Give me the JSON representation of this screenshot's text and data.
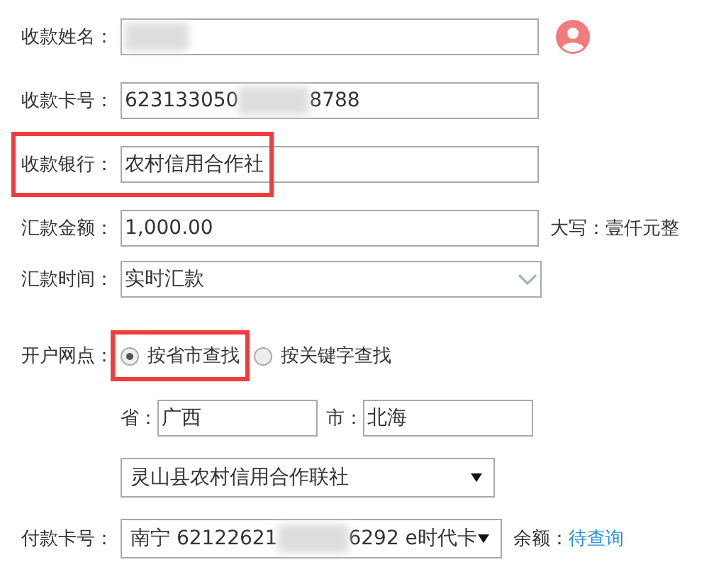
{
  "rows": [
    {
      "kind": "input",
      "label": "收款姓名：",
      "parts": [
        {
          "kind": "redacted"
        }
      ],
      "highlighted": false,
      "trailing": {
        "kind": "icon"
      }
    },
    {
      "kind": "input",
      "label": "收款卡号：",
      "parts": [
        {
          "kind": "text",
          "text": "623133050"
        },
        {
          "kind": "redacted"
        },
        {
          "kind": "text",
          "text": "8788"
        }
      ],
      "highlighted": false
    },
    {
      "kind": "input",
      "label": "收款银行：",
      "parts": [
        {
          "kind": "text",
          "text": "农村信用合作社"
        }
      ],
      "highlighted": true
    },
    {
      "kind": "input",
      "label": "汇款金额：",
      "parts": [
        {
          "kind": "text",
          "text": "1,000.00"
        }
      ],
      "highlighted": false,
      "trailing": {
        "kind": "note",
        "text": "大写：壹仟元整"
      }
    },
    {
      "kind": "dropdown",
      "label": "汇款时间：",
      "parts": [
        {
          "kind": "text",
          "text": "实时汇款"
        }
      ],
      "highlighted": false
    }
  ],
  "branch": {
    "label": "开户网点：",
    "options": [
      {
        "label": "按省市查找",
        "selected": true,
        "highlighted": true
      },
      {
        "label": "按关键字查找",
        "selected": false,
        "highlighted": false
      }
    ],
    "province": {
      "label": "省：",
      "value": "广西"
    },
    "city": {
      "label": "市：",
      "value": "北海"
    },
    "select": "灵山县农村信用合作联社"
  },
  "payer": {
    "label": "付款卡号：",
    "parts": [
      {
        "kind": "text",
        "text": "南宁 62122621"
      },
      {
        "kind": "redacted"
      },
      {
        "kind": "text",
        "text": "6292 e时代卡"
      }
    ],
    "balance_label": "余额：",
    "balance_link": "待查询"
  }
}
